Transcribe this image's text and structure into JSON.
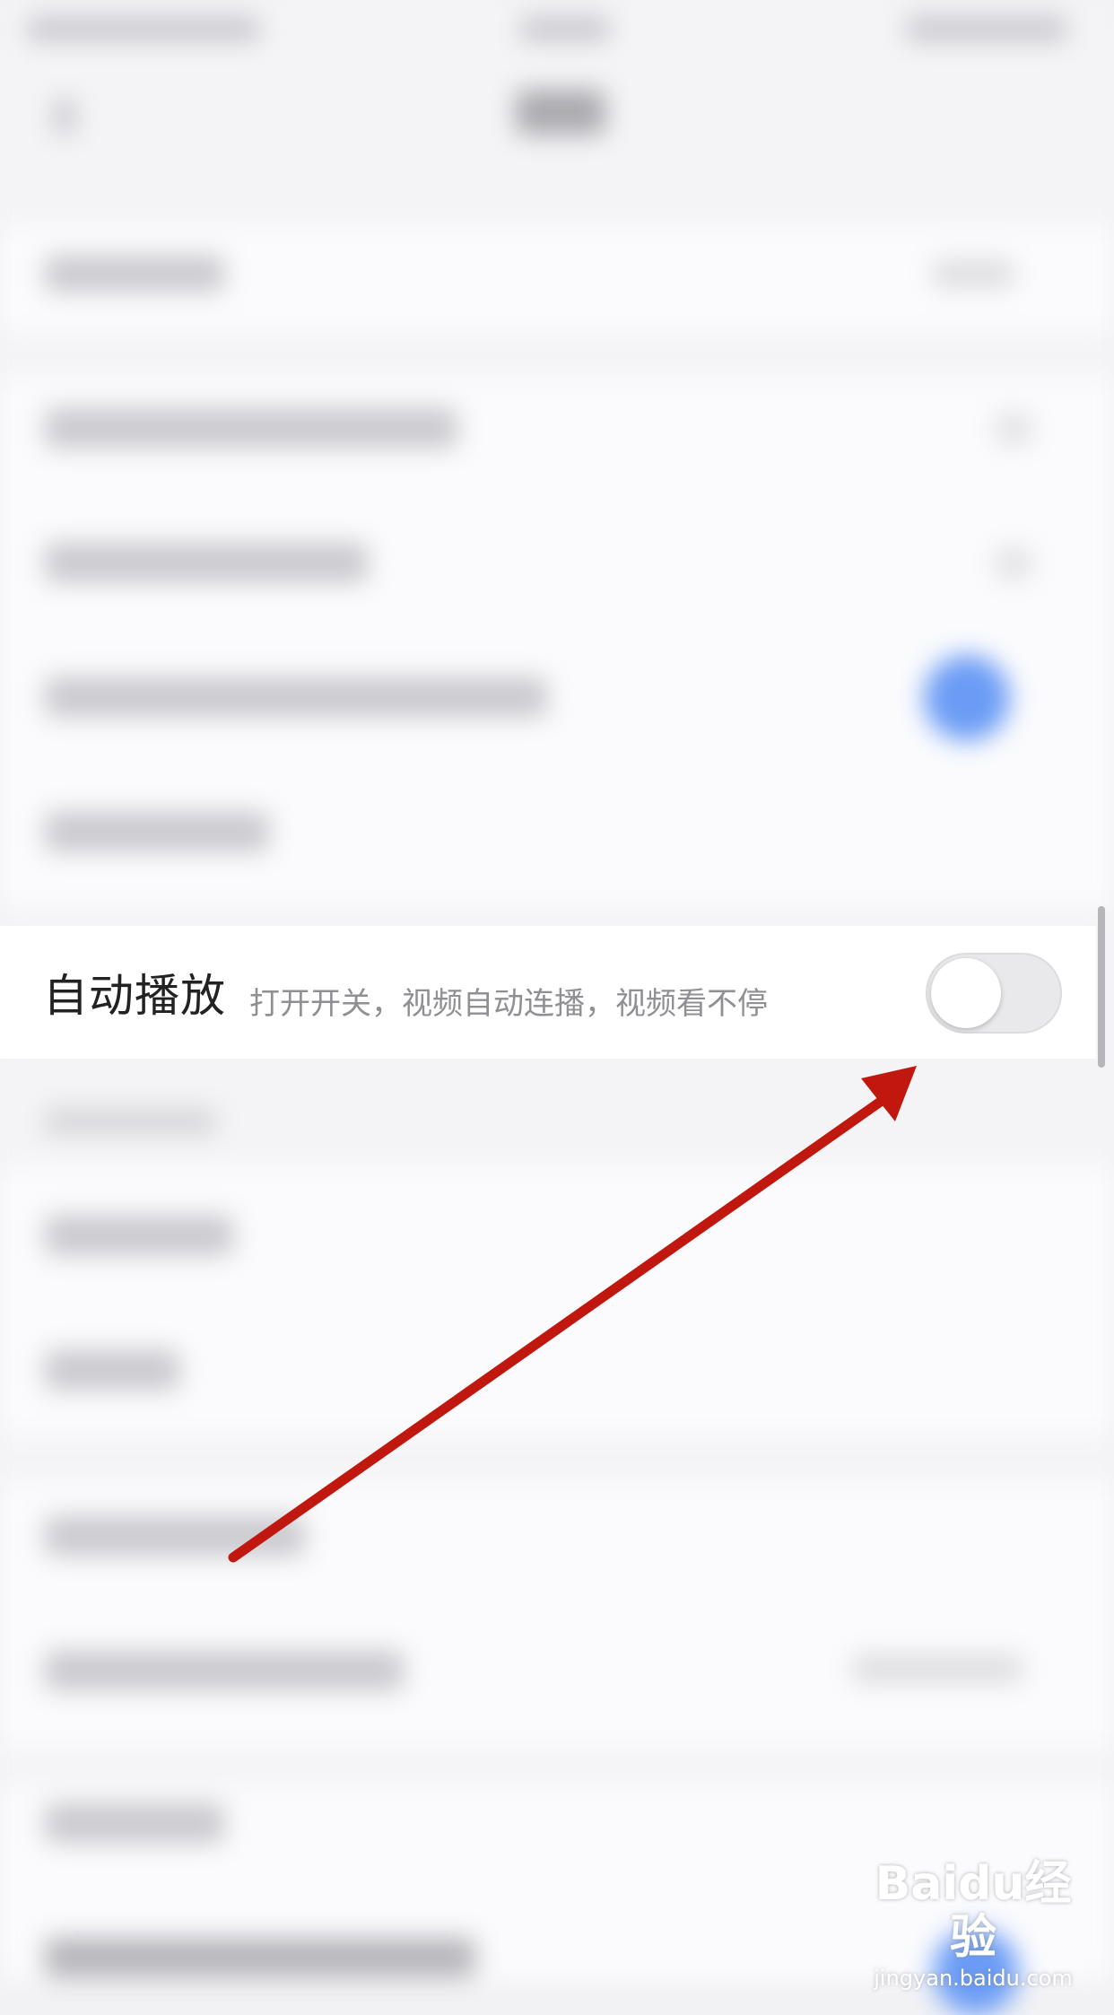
{
  "setting": {
    "title": "自动播放",
    "description": "打开开关，视频自动连播，视频看不停",
    "toggle_state": "off"
  },
  "watermark": {
    "main": "Baidu经验",
    "sub": "jingyan.baidu.com"
  },
  "colors": {
    "annotation_arrow": "#c0180f",
    "toggle_off_track": "#e9e9eb",
    "accent_blue": "#6a9cf5"
  }
}
